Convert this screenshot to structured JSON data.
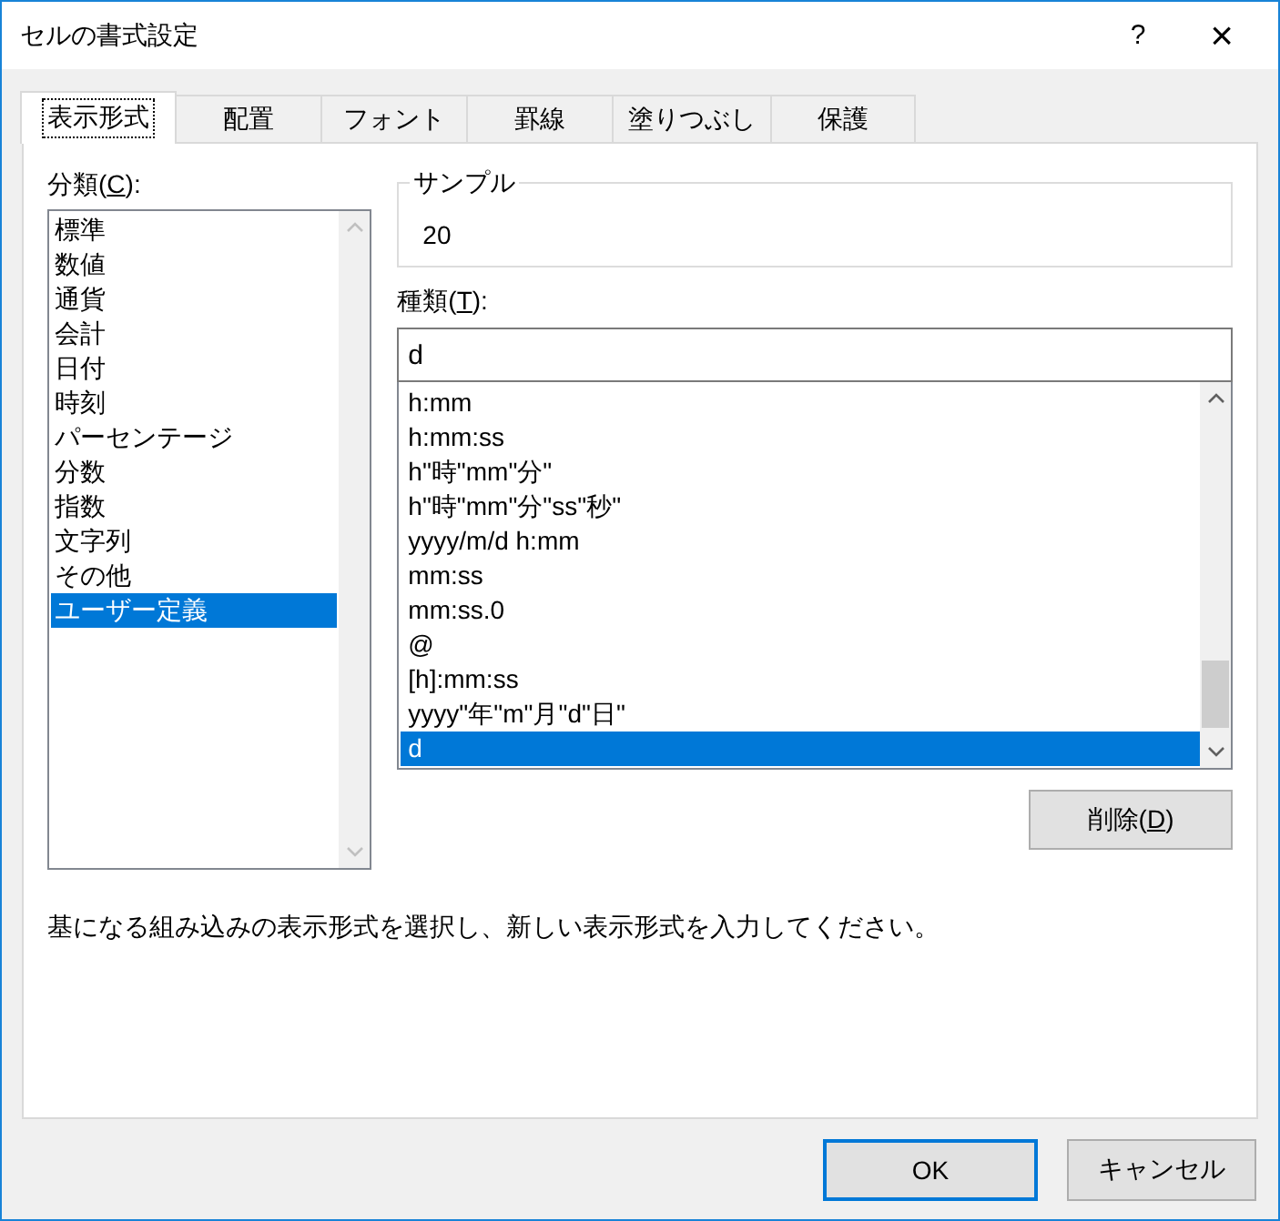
{
  "window": {
    "title": "セルの書式設定",
    "help": "?",
    "close": "×"
  },
  "tabs": [
    {
      "label": "表示形式",
      "selected": true
    },
    {
      "label": "配置",
      "selected": false
    },
    {
      "label": "フォント",
      "selected": false
    },
    {
      "label": "罫線",
      "selected": false
    },
    {
      "label": "塗りつぶし",
      "selected": false
    },
    {
      "label": "保護",
      "selected": false
    }
  ],
  "category": {
    "label_before": "分類(",
    "mnemonic": "C",
    "label_after": "):",
    "items": [
      {
        "label": "標準",
        "selected": false
      },
      {
        "label": "数値",
        "selected": false
      },
      {
        "label": "通貨",
        "selected": false
      },
      {
        "label": "会計",
        "selected": false
      },
      {
        "label": "日付",
        "selected": false
      },
      {
        "label": "時刻",
        "selected": false
      },
      {
        "label": "パーセンテージ",
        "selected": false
      },
      {
        "label": "分数",
        "selected": false
      },
      {
        "label": "指数",
        "selected": false
      },
      {
        "label": "文字列",
        "selected": false
      },
      {
        "label": "その他",
        "selected": false
      },
      {
        "label": "ユーザー定義",
        "selected": true
      }
    ]
  },
  "sample": {
    "legend": "サンプル",
    "value": "20"
  },
  "type": {
    "label_before": "種類(",
    "mnemonic": "T",
    "label_after": "):",
    "value": "d",
    "items": [
      {
        "label": "h:mm",
        "selected": false
      },
      {
        "label": "h:mm:ss",
        "selected": false
      },
      {
        "label": "h\"時\"mm\"分\"",
        "selected": false
      },
      {
        "label": "h\"時\"mm\"分\"ss\"秒\"",
        "selected": false
      },
      {
        "label": "yyyy/m/d h:mm",
        "selected": false
      },
      {
        "label": "mm:ss",
        "selected": false
      },
      {
        "label": "mm:ss.0",
        "selected": false
      },
      {
        "label": "@",
        "selected": false
      },
      {
        "label": "[h]:mm:ss",
        "selected": false
      },
      {
        "label": "yyyy\"年\"m\"月\"d\"日\"",
        "selected": false
      },
      {
        "label": "d",
        "selected": true
      }
    ]
  },
  "delete_button": {
    "label_before": "削除(",
    "mnemonic": "D",
    "label_after": ")"
  },
  "description": "基になる組み込みの表示形式を選択し、新しい表示形式を入力してください。",
  "buttons": [
    {
      "label": "OK",
      "default": true
    },
    {
      "label": "キャンセル",
      "default": false
    }
  ]
}
